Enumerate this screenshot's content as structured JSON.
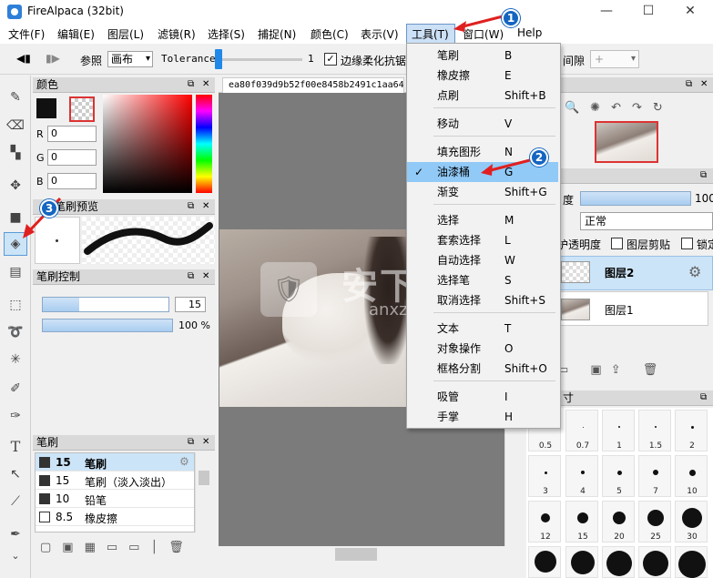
{
  "window": {
    "title": "FireAlpaca (32bit)",
    "minimize": "—",
    "maximize": "☐",
    "close": "✕"
  },
  "menubar": {
    "items": [
      "文件(F)",
      "编辑(E)",
      "图层(L)",
      "滤镜(R)",
      "选择(S)",
      "捕捉(N)",
      "颜色(C)",
      "表示(V)",
      "工具(T)",
      "窗口(W)",
      "Help"
    ]
  },
  "toolbar": {
    "ref_label": "参照",
    "ref_value": "画布",
    "tolerance_label": "Tolerance",
    "tolerance_value": "1",
    "antialias_label": "边缘柔化抗锯",
    "gap_label": "间隙",
    "gap_value": "+"
  },
  "panels": {
    "color": {
      "title": "颜色",
      "r": "0",
      "g": "0",
      "b": "0",
      "r_lbl": "R",
      "g_lbl": "G",
      "b_lbl": "B"
    },
    "brush_preview": {
      "title": "笔刷预览"
    },
    "brush_control": {
      "title": "笔刷控制",
      "size": "15",
      "opacity": "100 %"
    },
    "brush": {
      "title": "笔刷",
      "rows": [
        {
          "size": "15",
          "name": "笔刷",
          "selected": true
        },
        {
          "size": "15",
          "name": "笔刷（淡入淡出）",
          "selected": false
        },
        {
          "size": "10",
          "name": "铅笔",
          "selected": false
        },
        {
          "size": "8.5",
          "name": "橡皮擦",
          "selected": false
        }
      ]
    },
    "layer": {
      "opacity_label": "度",
      "opacity_value": "100",
      "blend": "正常",
      "protect_label": "护透明度",
      "clip_label": "图层剪贴",
      "lock_label": "锁定",
      "layers": [
        "图层2",
        "图层1"
      ]
    },
    "brush_size": {
      "title": "寸",
      "labels": [
        "0.5",
        "0.7",
        "1",
        "1.5",
        "2",
        "3",
        "4",
        "5",
        "7",
        "10",
        "12",
        "15",
        "20",
        "25",
        "30"
      ]
    }
  },
  "canvas": {
    "tab_title": "ea80f039d9b52f00e8458b2491c1aa64",
    "watermark": "安下载",
    "watermark_sub": "anxz.com"
  },
  "tools_menu": {
    "items": [
      {
        "label": "笔刷",
        "shortcut": "B"
      },
      {
        "label": "橡皮擦",
        "shortcut": "E"
      },
      {
        "label": "点刷",
        "shortcut": "Shift+B"
      },
      {
        "label": "移动",
        "shortcut": "V"
      },
      {
        "label": "填充图形",
        "shortcut": "N"
      },
      {
        "label": "油漆桶",
        "shortcut": "G",
        "checked": true
      },
      {
        "label": "渐变",
        "shortcut": "Shift+G"
      },
      {
        "label": "选择",
        "shortcut": "M"
      },
      {
        "label": "套索选择",
        "shortcut": "L"
      },
      {
        "label": "自动选择",
        "shortcut": "W"
      },
      {
        "label": "选择笔",
        "shortcut": "S"
      },
      {
        "label": "取消选择",
        "shortcut": "Shift+S"
      },
      {
        "label": "文本",
        "shortcut": "T"
      },
      {
        "label": "对象操作",
        "shortcut": "O"
      },
      {
        "label": "框格分割",
        "shortcut": "Shift+O"
      },
      {
        "label": "吸管",
        "shortcut": "I"
      },
      {
        "label": "手掌",
        "shortcut": "H"
      }
    ]
  },
  "callouts": [
    "1",
    "2",
    "3"
  ],
  "colors": {
    "accent": "#1f88e8",
    "highlight": "#91c9f7",
    "arrow": "#e02020",
    "badge": "#1565c0"
  }
}
